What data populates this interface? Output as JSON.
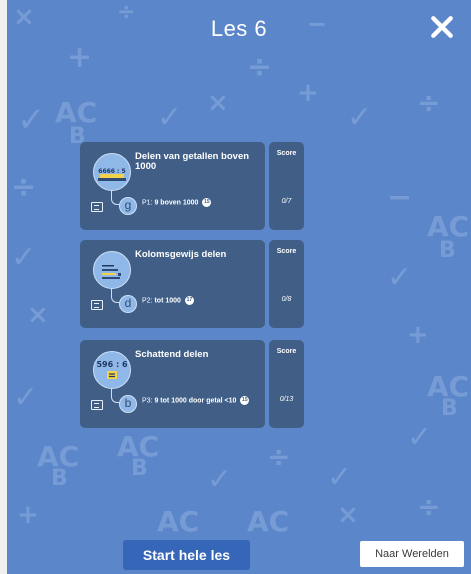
{
  "header": {
    "title": "Les 6"
  },
  "lessons": [
    {
      "title": "Delen van getallen boven 1000",
      "sub_prefix": "P1:",
      "sub_text": "9 boven 1000",
      "badge": "15",
      "level": "g",
      "score_label": "Score",
      "score": "0/7",
      "thumbnail_text": "6666 : 5"
    },
    {
      "title": "Kolomsgewijs delen",
      "sub_prefix": "P2:",
      "sub_text": "tot 1000",
      "badge": "17",
      "level": "d",
      "score_label": "Score",
      "score": "0/8",
      "thumbnail_text": ""
    },
    {
      "title": "Schattend delen",
      "sub_prefix": "P3:",
      "sub_text": "9 tot 1000 door getal <10",
      "badge": "15",
      "level": "b",
      "score_label": "Score",
      "score": "0/13",
      "thumbnail_text": "596 : 6"
    }
  ],
  "footer": {
    "start_label": "Start hele les",
    "worlds_label": "Naar Werelden"
  },
  "colors": {
    "background": "#5b86c9",
    "card": "#415f86",
    "primary_button": "#3566b7"
  }
}
